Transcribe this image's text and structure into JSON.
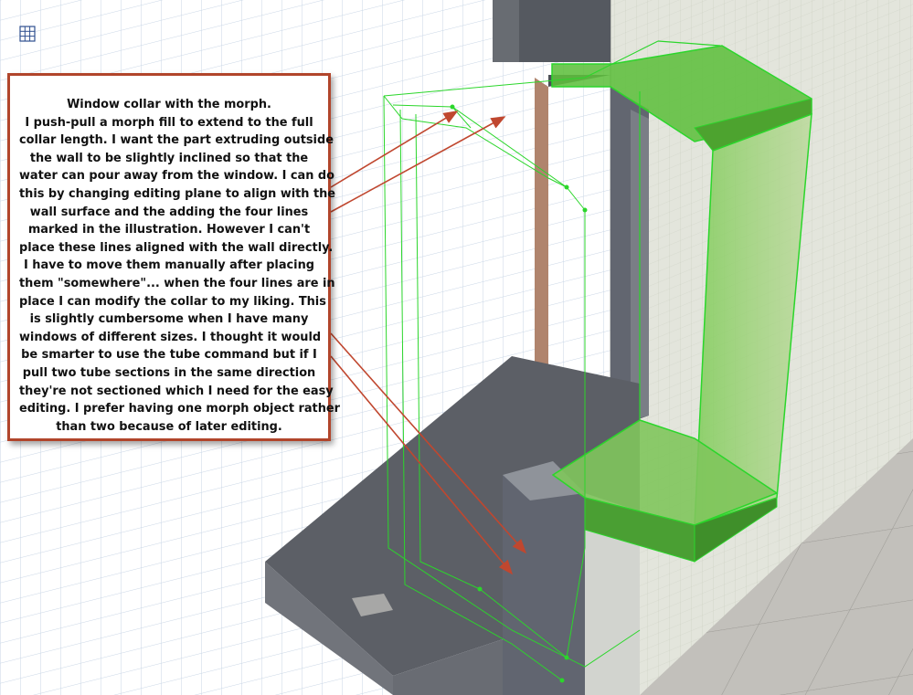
{
  "viewport": {
    "tool_icon": "grid-view-icon"
  },
  "callout": {
    "lines": [
      "Window collar with the morph.",
      "I push-pull a morph fill to extend to the full",
      "collar length. I want the part extruding outside",
      "the wall to be slightly inclined so that the",
      "water can pour away from the window. I can do",
      "this by changing editing plane to align with the",
      "wall surface and the adding the four lines",
      "marked in the illustration. However I can't",
      "place these lines aligned with the wall directly.",
      "I have to move them manually after placing",
      "them \"somewhere\"... when the four lines are in",
      "place I can modify the collar to my liking. This",
      "is slightly cumbersome when I have many",
      "windows of different sizes. I thought it would",
      "be smarter to use the tube command but if I",
      "pull two tube sections in the same direction",
      "they're not sectioned which I need for the easy",
      "editing. I prefer having one morph object rather",
      "than two because of later editing."
    ],
    "border_color": "#b1452b"
  },
  "colors": {
    "selection_green": "#2bd62b",
    "selected_fill": "#62c644",
    "arrow": "#c0472f",
    "wall_face": "#e2e4dc",
    "concrete": "#5a5d64",
    "floor": "#bcbab5",
    "grid_line": "#c3d1e1"
  }
}
